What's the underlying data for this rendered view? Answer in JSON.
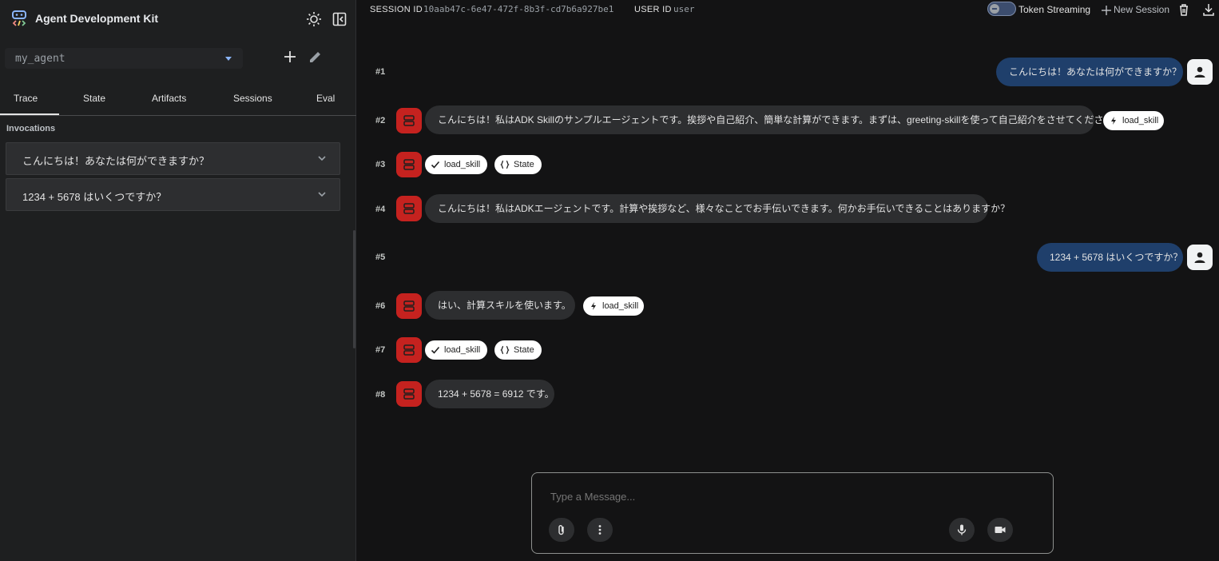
{
  "app": {
    "title": "Agent Development Kit"
  },
  "agent_select": {
    "value": "my_agent"
  },
  "tabs": [
    {
      "label": "Trace"
    },
    {
      "label": "State"
    },
    {
      "label": "Artifacts"
    },
    {
      "label": "Sessions"
    },
    {
      "label": "Eval"
    }
  ],
  "invocations": {
    "label": "Invocations",
    "items": [
      {
        "text": "こんにちは！あなたは何ができますか？"
      },
      {
        "text": "1234 + 5678 はいくつですか？"
      }
    ]
  },
  "topbar": {
    "session_label": "SESSION ID",
    "session_value": "10aab47c-6e47-472f-8b3f-cd7b6a927be1",
    "user_label": "USER ID",
    "user_value": "user",
    "streaming_label": "Token Streaming",
    "new_session_label": "New Session"
  },
  "messages": [
    {
      "num": "#1",
      "role": "user",
      "text": "こんにちは！あなたは何ができますか？"
    },
    {
      "num": "#2",
      "role": "bot",
      "text": "こんにちは！私はADK Skillのサンプルエージェントです。挨拶や自己紹介、簡単な計算ができます。まずは、greeting-skillを使って自己紹介をさせてください。",
      "chip": "load_skill"
    },
    {
      "num": "#3",
      "role": "bot",
      "chips": [
        "load_skill",
        "State"
      ]
    },
    {
      "num": "#4",
      "role": "bot",
      "text": "こんにちは！私はADKエージェントです。計算や挨拶など、様々なことでお手伝いできます。何かお手伝いできることはありますか？"
    },
    {
      "num": "#5",
      "role": "user",
      "text": "1234 + 5678 はいくつですか？"
    },
    {
      "num": "#6",
      "role": "bot",
      "text": "はい、計算スキルを使います。",
      "chip": "load_skill"
    },
    {
      "num": "#7",
      "role": "bot",
      "chips": [
        "load_skill",
        "State"
      ]
    },
    {
      "num": "#8",
      "role": "bot",
      "text": "1234 + 5678 = 6912 です。"
    }
  ],
  "composer": {
    "placeholder": "Type a Message..."
  },
  "icons": {
    "theme": "sun-icon",
    "sidebar_toggle": "panel-icon",
    "add": "plus-icon",
    "edit": "pencil-icon",
    "chevron": "chevron-down-icon",
    "bot": "robot-icon",
    "user": "person-icon",
    "bolt": "bolt-icon",
    "check": "check-icon",
    "braces": "braces-icon",
    "attach": "paperclip-icon",
    "more": "more-vert-icon",
    "mic": "mic-icon",
    "video": "video-icon",
    "delete": "trash-icon",
    "download": "download-icon"
  },
  "colors": {
    "bot_avatar": "#c5221f",
    "user_bubble": "#1f3f6b",
    "bot_bubble": "#2d2e30",
    "accent": "#8ab4f8"
  }
}
